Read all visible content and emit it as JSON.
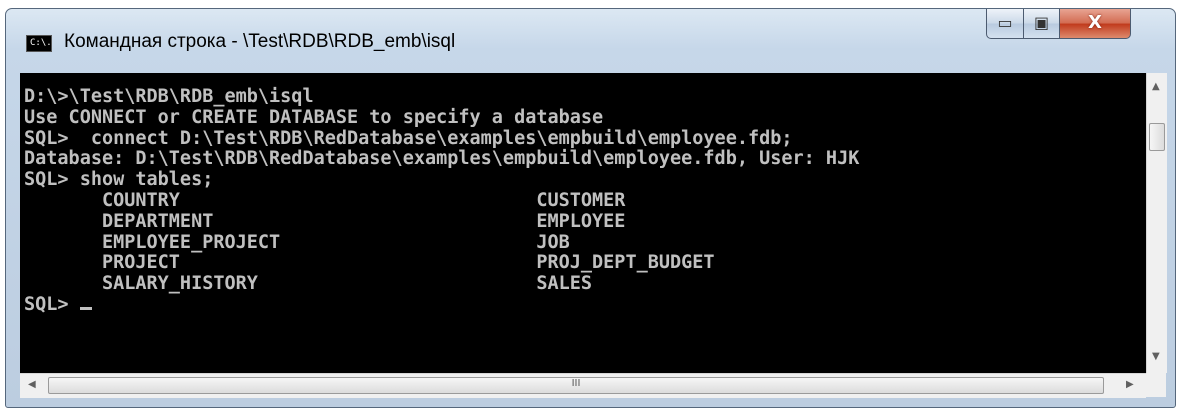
{
  "window": {
    "title": "Командная строка - \\Test\\RDB\\RDB_emb\\isql",
    "icon": "cmd-icon",
    "icon_text": "C:\\.",
    "minimize_icon": "▭",
    "maximize_icon": "▣",
    "close_icon": "X"
  },
  "console": {
    "lines": [
      "D:\\>\\Test\\RDB\\RDB_emb\\isql",
      "Use CONNECT or CREATE DATABASE to specify a database",
      "SQL>  connect D:\\Test\\RDB\\RedDatabase\\examples\\empbuild\\employee.fdb;",
      "Database: D:\\Test\\RDB\\RedDatabase\\examples\\empbuild\\employee.fdb, User: HJK",
      "SQL> show tables;",
      "       COUNTRY                                CUSTOMER",
      "       DEPARTMENT                             EMPLOYEE",
      "       EMPLOYEE_PROJECT                       JOB",
      "       PROJECT                                PROJ_DEPT_BUDGET",
      "       SALARY_HISTORY                         SALES"
    ],
    "prompt": "SQL> "
  },
  "scrollbars": {
    "up_arrow": "▲",
    "down_arrow": "▼",
    "left_arrow": "◀",
    "right_arrow": "▶",
    "h_grip": "III"
  }
}
